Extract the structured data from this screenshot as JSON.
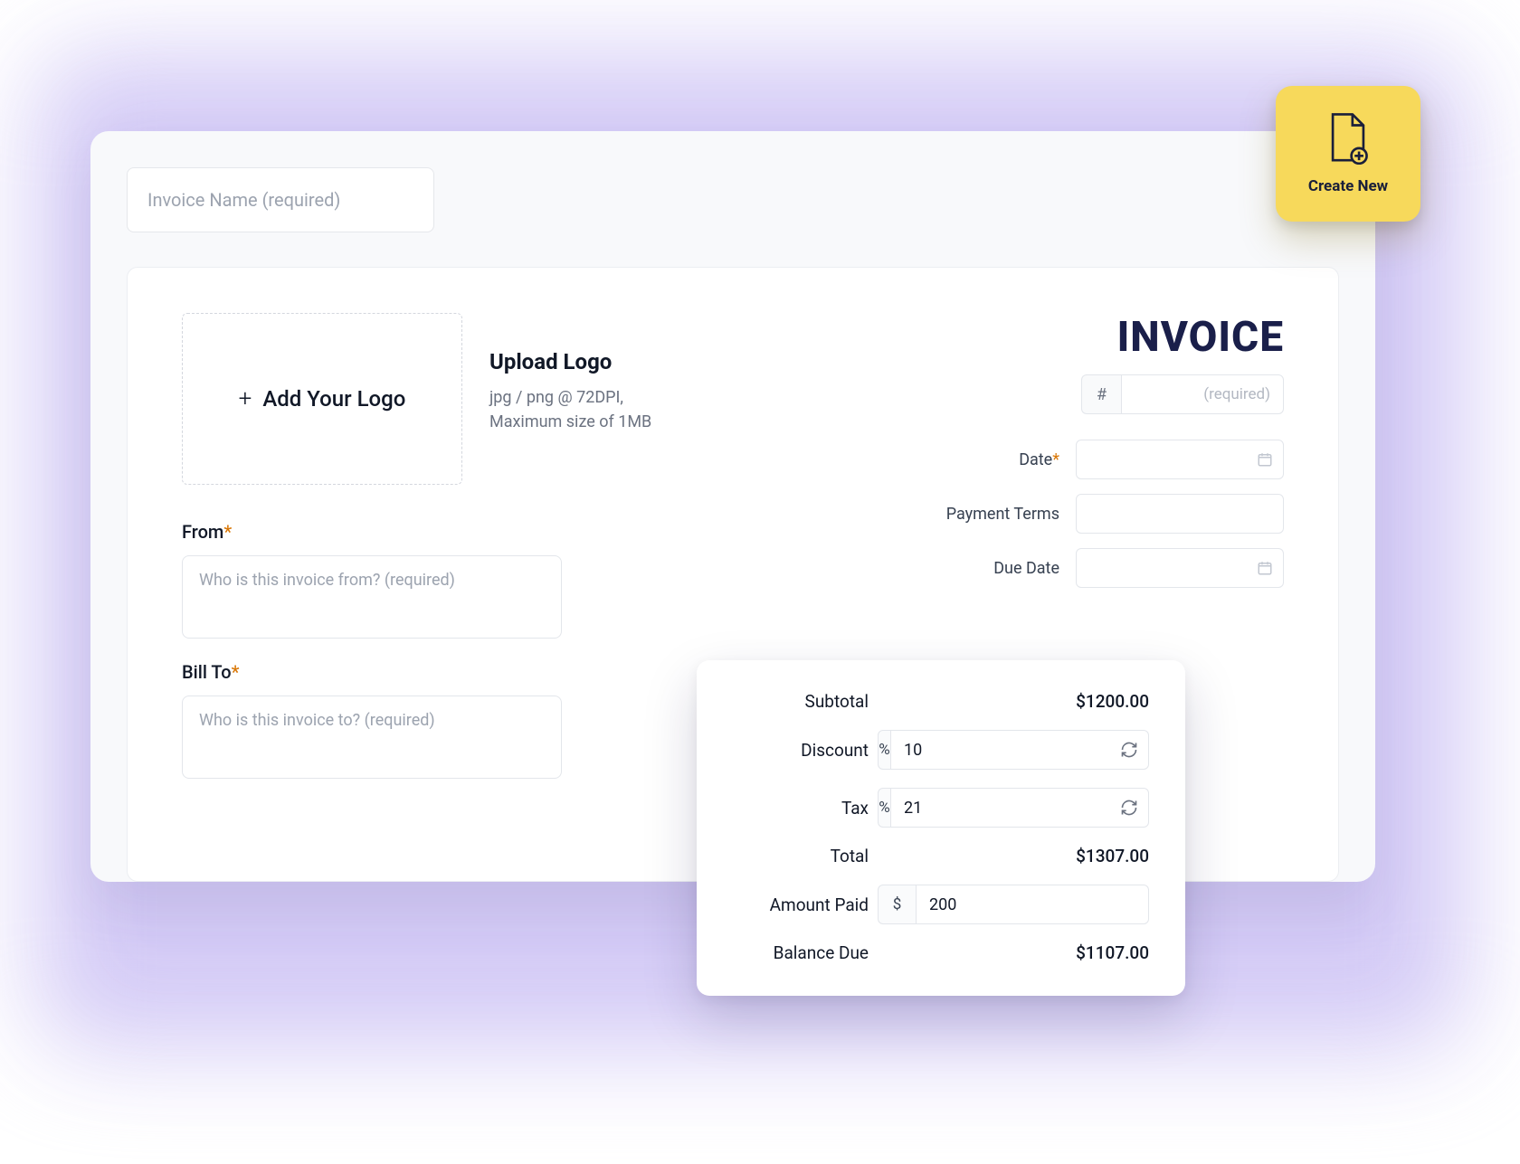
{
  "header": {
    "invoice_name_placeholder": "Invoice Name (required)"
  },
  "logo": {
    "add_label": "Add Your Logo",
    "upload_heading": "Upload Logo",
    "upload_hint_line1": "jpg / png @ 72DPI,",
    "upload_hint_line2": "Maximum size of 1MB"
  },
  "title": "INVOICE",
  "number": {
    "prefix": "#",
    "placeholder": "(required)"
  },
  "meta": {
    "date_label": "Date",
    "payment_terms_label": "Payment Terms",
    "due_date_label": "Due Date"
  },
  "from": {
    "label": "From",
    "placeholder": "Who is this invoice from? (required)"
  },
  "bill_to": {
    "label": "Bill To",
    "placeholder": "Who is this invoice to? (required)"
  },
  "totals": {
    "subtotal_label": "Subtotal",
    "subtotal_value": "$1200.00",
    "discount_label": "Discount",
    "discount_unit": "%",
    "discount_value": "10",
    "tax_label": "Tax",
    "tax_unit": "%",
    "tax_value": "21",
    "total_label": "Total",
    "total_value": "$1307.00",
    "amount_paid_label": "Amount Paid",
    "amount_paid_unit": "$",
    "amount_paid_value": "200",
    "balance_due_label": "Balance Due",
    "balance_due_value": "$1107.00"
  },
  "create_new": {
    "label": "Create New"
  }
}
